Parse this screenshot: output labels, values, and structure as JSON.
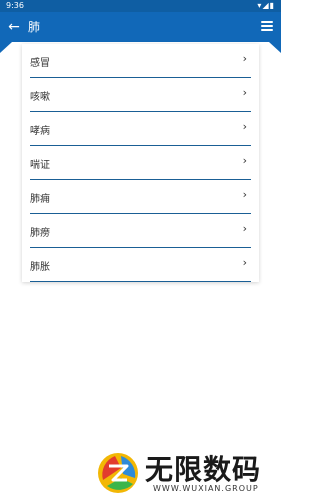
{
  "status_bar": {
    "time": "9:36"
  },
  "app_bar": {
    "title": "肺",
    "accent_color": "#1168b8"
  },
  "list": {
    "items": [
      {
        "label": "感冒"
      },
      {
        "label": "咳嗽"
      },
      {
        "label": "哮病"
      },
      {
        "label": "喘证"
      },
      {
        "label": "肺痈"
      },
      {
        "label": "肺痨"
      },
      {
        "label": "肺胀"
      }
    ]
  },
  "watermark": {
    "text": "无限数码",
    "subtext": "WWW.WUXIAN.GROUP"
  }
}
